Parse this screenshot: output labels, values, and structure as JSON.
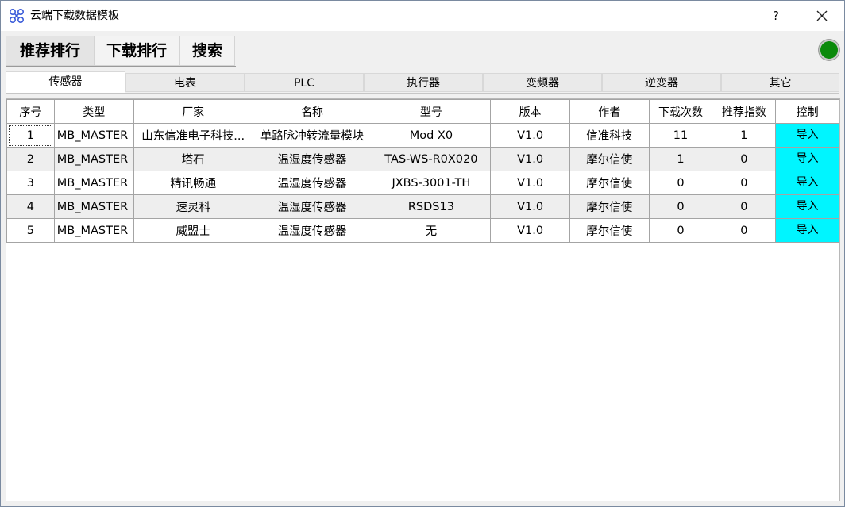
{
  "window": {
    "title": "云端下载数据模板",
    "help_label": "?"
  },
  "main_tabs": [
    {
      "label": "推荐排行",
      "active": true
    },
    {
      "label": "下载排行",
      "active": false
    },
    {
      "label": "搜索",
      "active": false
    }
  ],
  "status": {
    "connected": true,
    "color": "#0a8a0a"
  },
  "sub_tabs": [
    {
      "label": "传感器",
      "active": true
    },
    {
      "label": "电表"
    },
    {
      "label": "PLC"
    },
    {
      "label": "执行器"
    },
    {
      "label": "变频器"
    },
    {
      "label": "逆变器"
    },
    {
      "label": "其它"
    }
  ],
  "table": {
    "columns": [
      "序号",
      "类型",
      "厂家",
      "名称",
      "型号",
      "版本",
      "作者",
      "下载次数",
      "推荐指数",
      "控制"
    ],
    "rows": [
      {
        "index": "1",
        "type": "MB_MASTER",
        "vendor": "山东信准电子科技...",
        "name": "单路脉冲转流量模块",
        "model": "Mod X0",
        "version": "V1.0",
        "author": "信准科技",
        "downloads": "11",
        "recommend": "1",
        "action": "导入"
      },
      {
        "index": "2",
        "type": "MB_MASTER",
        "vendor": "塔石",
        "name": "温湿度传感器",
        "model": "TAS-WS-R0X020",
        "version": "V1.0",
        "author": "摩尔信使",
        "downloads": "1",
        "recommend": "0",
        "action": "导入"
      },
      {
        "index": "3",
        "type": "MB_MASTER",
        "vendor": "精讯畅通",
        "name": "温湿度传感器",
        "model": "JXBS-3001-TH",
        "version": "V1.0",
        "author": "摩尔信使",
        "downloads": "0",
        "recommend": "0",
        "action": "导入"
      },
      {
        "index": "4",
        "type": "MB_MASTER",
        "vendor": "速灵科",
        "name": "温湿度传感器",
        "model": "RSDS13",
        "version": "V1.0",
        "author": "摩尔信使",
        "downloads": "0",
        "recommend": "0",
        "action": "导入"
      },
      {
        "index": "5",
        "type": "MB_MASTER",
        "vendor": "威盟士",
        "name": "温湿度传感器",
        "model": "无",
        "version": "V1.0",
        "author": "摩尔信使",
        "downloads": "0",
        "recommend": "0",
        "action": "导入"
      }
    ],
    "import_color": "#00f5ff"
  }
}
